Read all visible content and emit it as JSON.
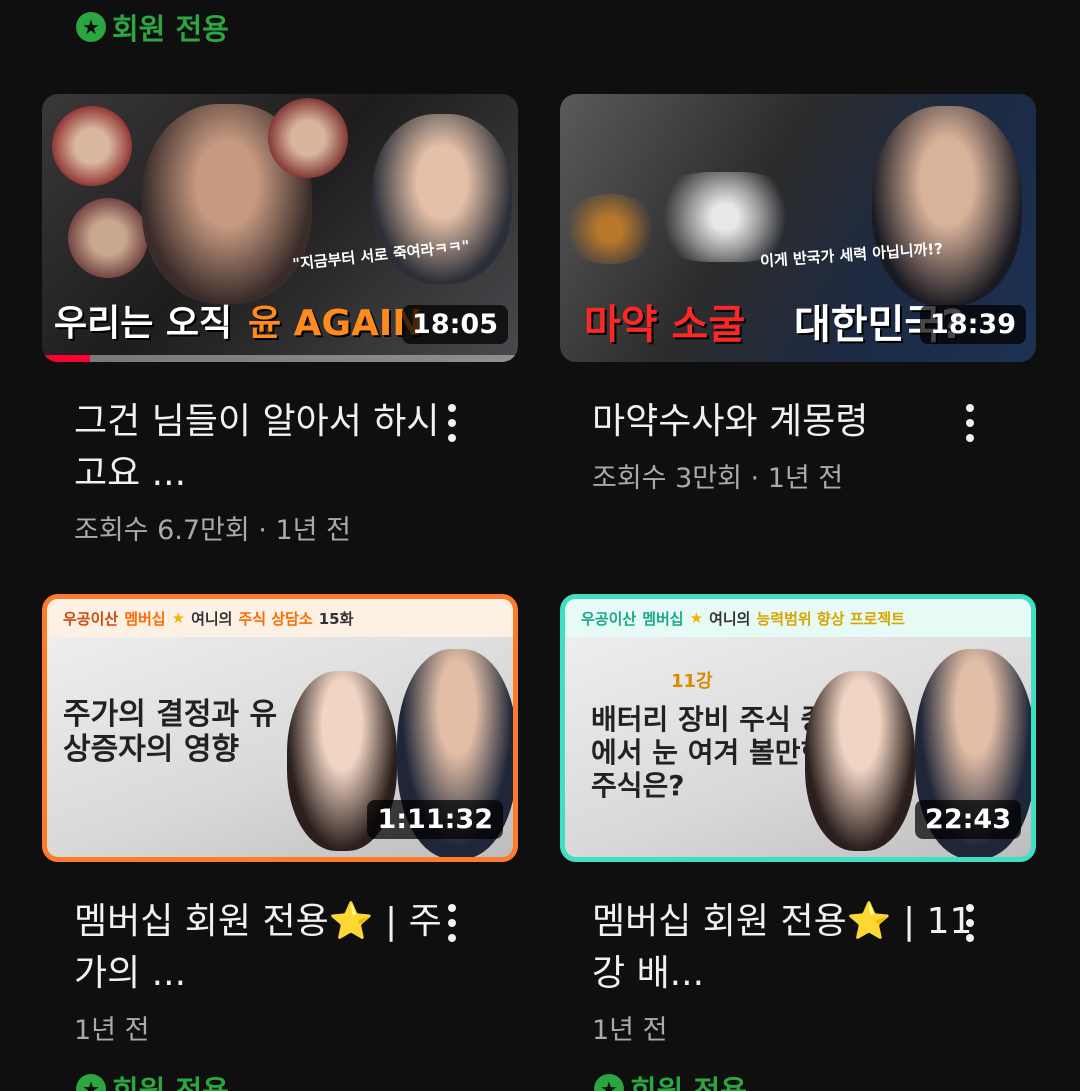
{
  "section_badges": {
    "top": "회원 전용",
    "bottom_left": "회원 전용",
    "bottom_right": "회원 전용"
  },
  "videos": [
    {
      "title": "그건 님들이 알아서 하시고요 ...",
      "sub": "조회수 6.7만회 · 1년 전",
      "duration": "18:05",
      "progress": 0.1,
      "thumb_text": {
        "caption_white": "우리는 오직",
        "caption_orange": "윤 AGAIN",
        "quote": "\"지금부터 서로 죽여라ㅋㅋ\""
      }
    },
    {
      "title": "마약수사와 계몽령",
      "sub": "조회수 3만회 · 1년 전",
      "duration": "18:39",
      "thumb_text": {
        "caption_red": "마약 소굴",
        "caption_white": "대한민국?",
        "quote": "이게 반국가 세력 아닙니까!?"
      }
    },
    {
      "title": "멤버십 회원 전용⭐ | 주가의 ...",
      "sub": "1년 전",
      "duration": "1:11:32",
      "thumb_text": {
        "strip_a": "우공이산",
        "strip_b": "멤버십",
        "strip_c": "여니의",
        "strip_d": "주식 상담소",
        "strip_e": "15화",
        "headline": "주가의 결정과 유상증자의 영향"
      }
    },
    {
      "title": "멤버십 회원 전용⭐ | 11강 배...",
      "sub": "1년 전",
      "duration": "22:43",
      "thumb_text": {
        "strip_a": "우공이산",
        "strip_b": "멤버십",
        "strip_c": "여니의",
        "strip_d": "능력범위 향상 프로젝트",
        "lesson": "11강",
        "headline": "배터리 장비 주식 중에서 눈 여겨 볼만한 주식은?"
      }
    }
  ],
  "colors": {
    "background": "#0f0f0f",
    "members_green": "#2ba640",
    "progress_red": "#ff0033"
  },
  "icons": [
    "star-badge-icon",
    "more-vert-icon"
  ]
}
